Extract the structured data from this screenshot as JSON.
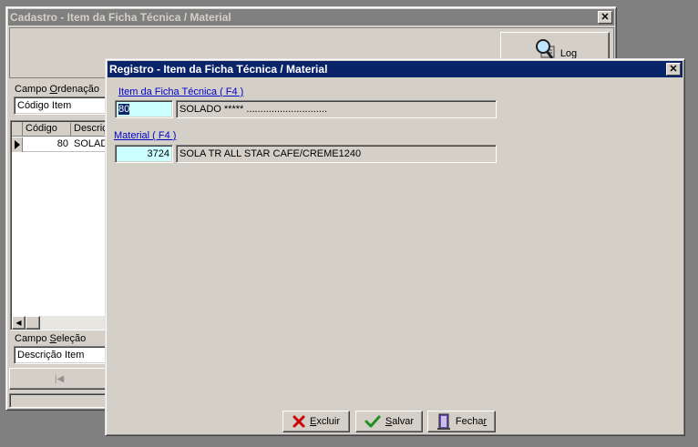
{
  "back_window": {
    "title": "Cadastro - Item da Ficha Técnica / Material",
    "close_glyph": "✕",
    "log_button_label": "Log",
    "campo_ordenacao": {
      "label_pre": "Campo ",
      "label_u": "O",
      "label_post": "rdenação",
      "value": "Código Item"
    },
    "grid": {
      "columns": [
        "Código",
        "Descriç"
      ],
      "rows": [
        {
          "codigo": "80",
          "descricao": "SOLAD"
        }
      ]
    },
    "campo_selecao": {
      "label_pre": "Campo ",
      "label_u": "S",
      "label_post": "eleção",
      "value": "Descrição Item"
    },
    "nav_glyph": "|◀",
    "scroll_left_glyph": "◀"
  },
  "front_window": {
    "title": "Registro - Item da Ficha Técnica / Material",
    "close_glyph": "✕",
    "item_label": "Item da Ficha Técnica ( F4 )",
    "item_code": "80",
    "item_desc": "SOLADO *****  .............................",
    "material_label": "Material ( F4 )",
    "material_code": "3724",
    "material_desc": "SOLA TR ALL STAR  CAFE/CREME1240",
    "buttons": {
      "excluir": {
        "u": "E",
        "rest": "xcluir"
      },
      "salvar": {
        "u": "S",
        "rest": "alvar"
      },
      "fechar": {
        "pre": "Fecha",
        "u": "r"
      }
    }
  }
}
